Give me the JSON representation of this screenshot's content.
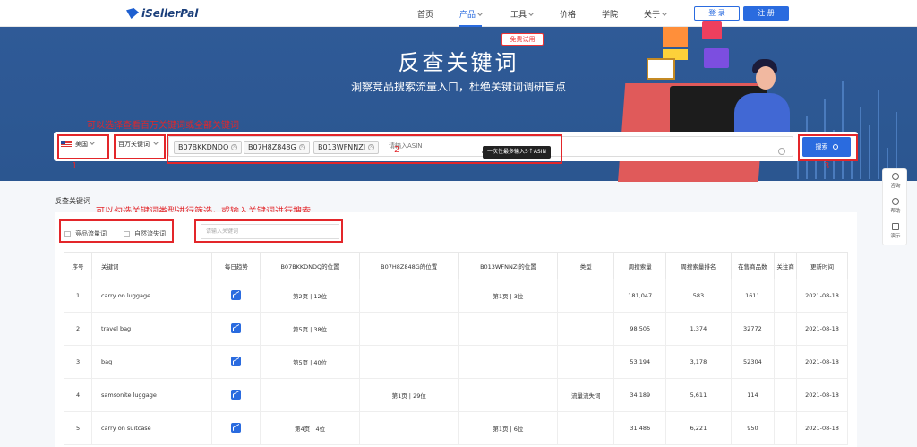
{
  "brand": {
    "logo_text": "iSellerPal"
  },
  "nav": {
    "items": [
      {
        "label": "首页",
        "dropdown": false,
        "active": false
      },
      {
        "label": "产品",
        "dropdown": true,
        "active": true
      },
      {
        "label": "工具",
        "dropdown": true,
        "active": false
      },
      {
        "label": "价格",
        "dropdown": false,
        "active": false
      },
      {
        "label": "学院",
        "dropdown": false,
        "active": false
      },
      {
        "label": "关于",
        "dropdown": true,
        "active": false
      }
    ],
    "login": "登 录",
    "register": "注 册"
  },
  "hero": {
    "title": "反查关键词",
    "tag": "免费试用",
    "subtitle": "洞察竞品搜索流量入口，杜绝关键词调研盲点"
  },
  "search": {
    "country": "美国",
    "keyword_scope": "百万关键词",
    "asins": [
      "B07BKKDNDQ",
      "B07H8Z848G",
      "B013WFNNZI"
    ],
    "asin_placeholder": "请输入ASIN",
    "tooltip": "一次性最多输入5个ASIN",
    "search_button": "搜索"
  },
  "annotations": {
    "a1_text": "可以选择查看百万关键词或全部关键词",
    "a2_text": "可以勾选关键词类型进行筛选，或输入关键词进行搜索",
    "num1": "1",
    "num2": "2",
    "num3": "3"
  },
  "results": {
    "section_title": "反查关键词",
    "filters": [
      "竞品流量词",
      "自然流失词"
    ],
    "keyword_placeholder": "请输入关键词",
    "columns": [
      "序号",
      "关键词",
      "每日趋势",
      "B07BKKDNDQ的位置",
      "B07H8Z848G的位置",
      "B013WFNNZI的位置",
      "类型",
      "周搜索量",
      "周搜索量排名",
      "在售商品数",
      "关注商",
      "更新时间"
    ],
    "rows": [
      {
        "idx": "1",
        "keyword": "carry on luggage",
        "pos1": "第2页 | 12位",
        "pos2": "",
        "pos3": "第1页 | 3位",
        "type": "",
        "weekly_search": "181,047",
        "rank": "583",
        "products": "1611",
        "follow": "",
        "updated": "2021-08-18"
      },
      {
        "idx": "2",
        "keyword": "travel bag",
        "pos1": "第5页 | 38位",
        "pos2": "",
        "pos3": "",
        "type": "",
        "weekly_search": "98,505",
        "rank": "1,374",
        "products": "32772",
        "follow": "",
        "updated": "2021-08-18"
      },
      {
        "idx": "3",
        "keyword": "bag",
        "pos1": "第5页 | 40位",
        "pos2": "",
        "pos3": "",
        "type": "",
        "weekly_search": "53,194",
        "rank": "3,178",
        "products": "52304",
        "follow": "",
        "updated": "2021-08-18"
      },
      {
        "idx": "4",
        "keyword": "samsonite luggage",
        "pos1": "",
        "pos2": "第1页 | 29位",
        "pos3": "",
        "type": "流量流失词",
        "weekly_search": "34,189",
        "rank": "5,611",
        "products": "114",
        "follow": "",
        "updated": "2021-08-18"
      },
      {
        "idx": "5",
        "keyword": "carry on suitcase",
        "pos1": "第4页 | 4位",
        "pos2": "",
        "pos3": "第1页 | 6位",
        "type": "",
        "weekly_search": "31,486",
        "rank": "6,221",
        "products": "950",
        "follow": "",
        "updated": "2021-08-18"
      }
    ]
  },
  "right_sidebar": {
    "items": [
      {
        "label": "咨询",
        "icon": "chat-icon"
      },
      {
        "label": "帮助",
        "icon": "help-icon"
      },
      {
        "label": "演示",
        "icon": "demo-icon"
      }
    ]
  },
  "colors": {
    "primary": "#2a6bdf",
    "hero_bg": "#2f5a97",
    "annotation": "#e3262a"
  }
}
